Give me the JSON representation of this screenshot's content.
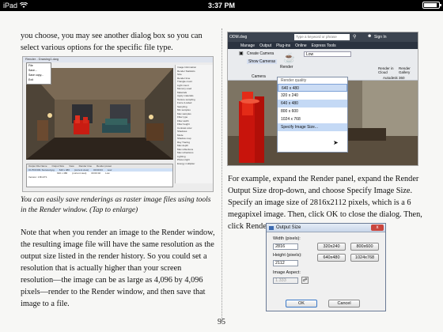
{
  "status_bar": {
    "carrier": "iPad",
    "time": "3:37 PM",
    "wifi_icon": "wifi-icon",
    "battery_icon": "battery-icon"
  },
  "book": {
    "left": {
      "para1": "you choose, you may see another dialog box so you can select various options for the specific file type.",
      "caption": "You can easily save renderings as raster image files using tools in the Render window. (Tap to enlarge)",
      "para2": "Note that when you render an image to the Render window, the resulting image file will have the same resolution as the output size listed in the render history. So you could set a resolution that is actually higher than your screen resolution—the image can be as large as 4,096 by 4,096 pixels—render to the Render window, and then save that image to a file."
    },
    "right": {
      "para": "For example, expand the Render panel, expand the Render Output Size drop-down, and choose Specify Image Size. Specify an image size of 2816x2112 pixels, which is a 6 megapixel image. Then, click OK to close the dialog. Then, click Render."
    },
    "page_number": "95"
  },
  "fig1": {
    "title": "Render - Drawing1.dwg",
    "menu_items": [
      "File",
      "Save...",
      "Save copy...",
      "Exit"
    ],
    "panel_lines": [
      "Image Information",
      "Render Statistics",
      "Size",
      "Render time",
      "Triangle count",
      "Light count",
      "Memory used",
      "Materials",
      "Apply materials",
      "Texture sampling",
      "Force 2-sided",
      "Sampling",
      "Min samples",
      "Max samples",
      "Filter type",
      "Filter width",
      "Filter height",
      "Contrast color",
      "Shadows",
      "Mode",
      "Shadow map",
      "Ray Tracing",
      "Max depth",
      "Max reflections",
      "Max refractions",
      "Lighting",
      "Photon light",
      "Energy multiplier"
    ],
    "table_headers": [
      "Output File Name",
      "Output Size",
      "View",
      "Render time",
      "Render preset"
    ],
    "table_rows": [
      [
        "OUTDOOR-Textured.jpg",
        "640 x 480",
        "{current view}",
        "00:00:03",
        "Low"
      ],
      [
        "",
        "640 x 480",
        "{current view}",
        "00:00:02",
        "Low"
      ]
    ],
    "status": "Version: 1:B1UT1"
  },
  "fig2": {
    "file_title": "ODM.dwg",
    "search_placeholder": "Type a keyword or phrase",
    "sign_in": "Sign In",
    "menu_items": [
      "Manage",
      "Output",
      "Plug-ins",
      "Online",
      "Express Tools"
    ],
    "create_camera": "Create Camera",
    "show_cameras": "Show Cameras",
    "render_label": "Render",
    "render_quality_label": "Render quality",
    "quality_value": "Low",
    "panel_label": "Camera",
    "render_in_cloud": "Render in Cloud",
    "render_gallery": "Render Gallery",
    "autodesk_360": "Autodesk 360",
    "dropdown_items": [
      "640 x 480",
      "320 x 240",
      "640 x 480",
      "800 x 600",
      "1024 x 768",
      "Specify Image Size..."
    ]
  },
  "fig3": {
    "title": "Output Size",
    "width_label": "Width (pixels):",
    "width_value": "2816",
    "height_label": "Height (pixels):",
    "height_value": "2112",
    "aspect_label": "Image Aspect:",
    "aspect_value": "1.333",
    "presets": [
      "320x240",
      "800x600",
      "640x480",
      "1024x768"
    ],
    "ok": "OK",
    "cancel": "Cancel",
    "close": "x"
  }
}
